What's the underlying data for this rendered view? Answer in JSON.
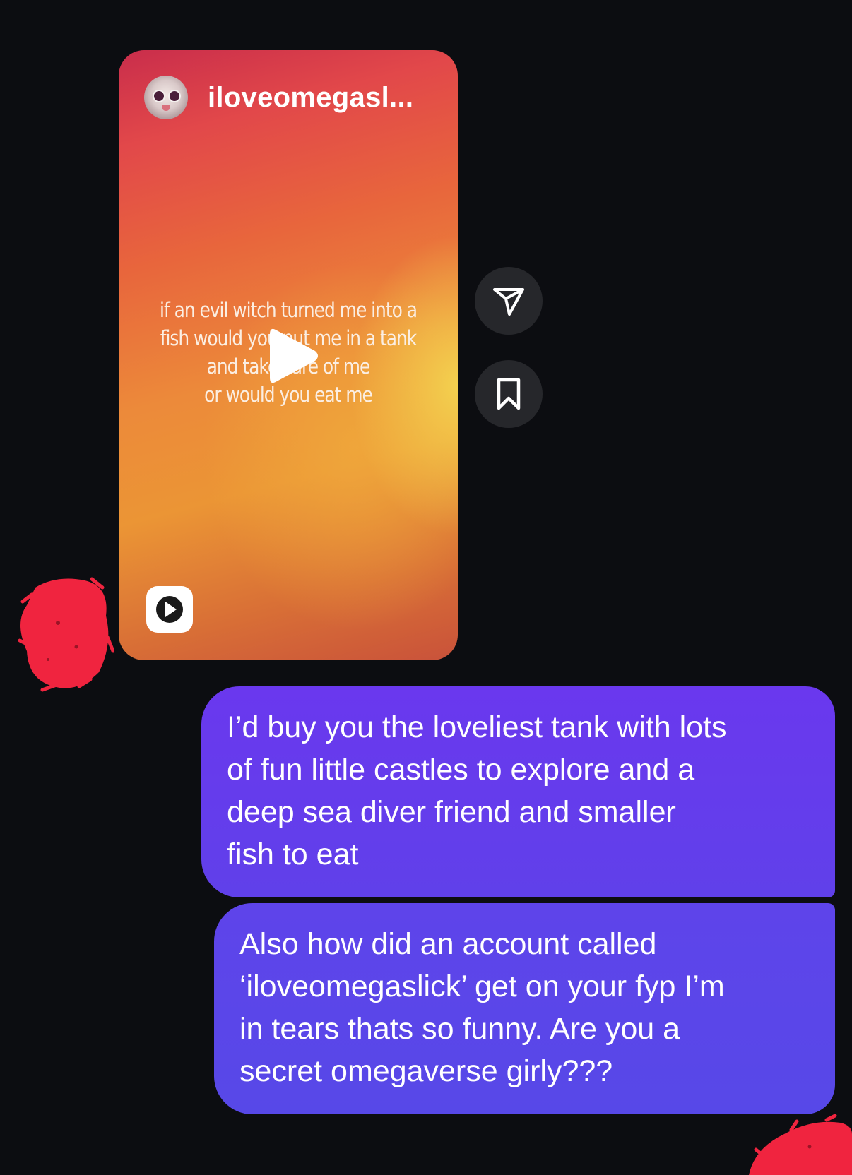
{
  "reel": {
    "username": "iloveomegasl...",
    "caption_lines": [
      "if an evil witch turned me into a",
      "fish would you put me in a tank",
      "and take care of me",
      "or  would you eat me"
    ],
    "gradient_colors": [
      "#c92d4b",
      "#e8663c",
      "#f4d450",
      "#c9523a"
    ]
  },
  "actions": {
    "share_icon": "paper-plane-icon",
    "save_icon": "bookmark-icon"
  },
  "messages": [
    {
      "lines": [
        "I’d buy you the loveliest tank with lots",
        "of fun little castles to explore and a",
        "deep sea diver friend and smaller",
        "fish to eat"
      ]
    },
    {
      "lines": [
        "Also how did an account called",
        "‘iloveomegaslick’ get on your fyp I’m",
        "in tears thats so funny. Are you a",
        "secret omegaverse girly???"
      ]
    }
  ],
  "colors": {
    "background": "#0c0d11",
    "bubble_primary": "#6a38ee",
    "bubble_secondary": "#5748e8",
    "action_button": "#26272b",
    "redaction": "#f0243f"
  }
}
